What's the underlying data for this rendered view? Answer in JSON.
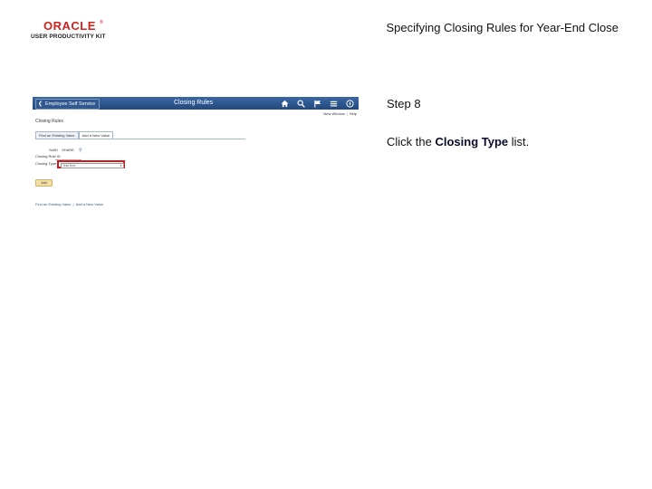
{
  "logo": {
    "brand": "ORACLE",
    "registered": "®",
    "product": "USER PRODUCTIVITY KIT"
  },
  "slide": {
    "title": "Specifying Closing Rules for Year-End Close",
    "step": "Step 8",
    "instruction_prefix": "Click the ",
    "instruction_target": "Closing Type",
    "instruction_suffix": " list."
  },
  "screenshot": {
    "back_button": "Employee Self Service",
    "header_title": "Closing Rules",
    "icons": [
      "home-icon",
      "search-icon",
      "flag-icon",
      "menu-icon",
      "compass-icon"
    ],
    "links": [
      "New Window",
      "Help"
    ],
    "page_title": "Closing Rules",
    "tabs": [
      "Find an Existing Value",
      "Add a New Value"
    ],
    "fields": {
      "setid_label": "SetID",
      "setid_value": "SHARE",
      "closing_id_label": "Closing Rule ID",
      "closing_type_label": "Closing Type",
      "closing_type_value": "Year End"
    },
    "add_button": "Add",
    "footer_links": [
      "Find an Existing Value",
      "Add a New Value"
    ]
  },
  "colors": {
    "header_blue": "#2b5188",
    "highlight_red": "#d01818",
    "oracle_red": "#d0211d",
    "add_button": "#f3dfa6"
  }
}
